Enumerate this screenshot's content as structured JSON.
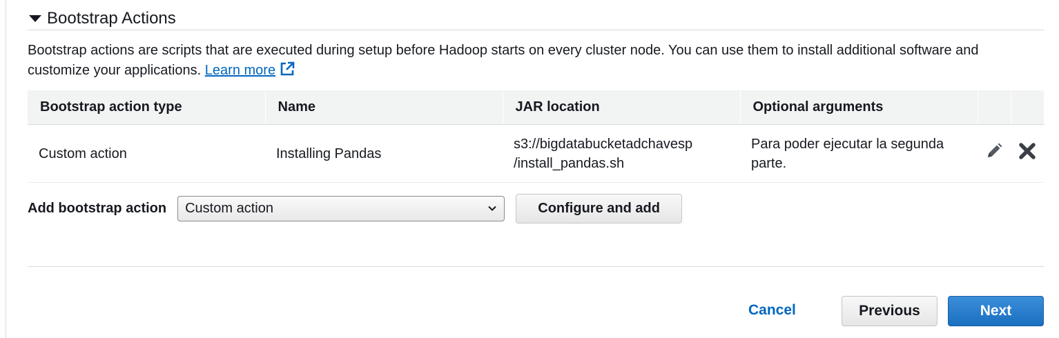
{
  "section": {
    "title": "Bootstrap Actions"
  },
  "description": {
    "text": "Bootstrap actions are scripts that are executed during setup before Hadoop starts on every cluster node. You can use them to install additional software and customize your applications.",
    "link_label": "Learn more",
    "link_icon": "external-link-icon"
  },
  "table": {
    "columns": [
      "Bootstrap action type",
      "Name",
      "JAR location",
      "Optional arguments"
    ],
    "rows": [
      {
        "type": "Custom action",
        "name": "Installing Pandas",
        "jar_line1": "s3://bigdatabucketadchavesp",
        "jar_line2": "/install_pandas.sh",
        "args_line1": "Para poder ejecutar la segunda",
        "args_line2": "parte.",
        "edit_icon": "pencil-icon",
        "delete_icon": "close-icon"
      }
    ]
  },
  "add_action": {
    "label": "Add bootstrap action",
    "selected": "Custom action",
    "configure_label": "Configure and add"
  },
  "footer": {
    "cancel_label": "Cancel",
    "previous_label": "Previous",
    "next_label": "Next"
  },
  "colors": {
    "link": "#0066c0",
    "primary_button": "#1a6fc0",
    "header_bg": "#f2f3f3"
  }
}
